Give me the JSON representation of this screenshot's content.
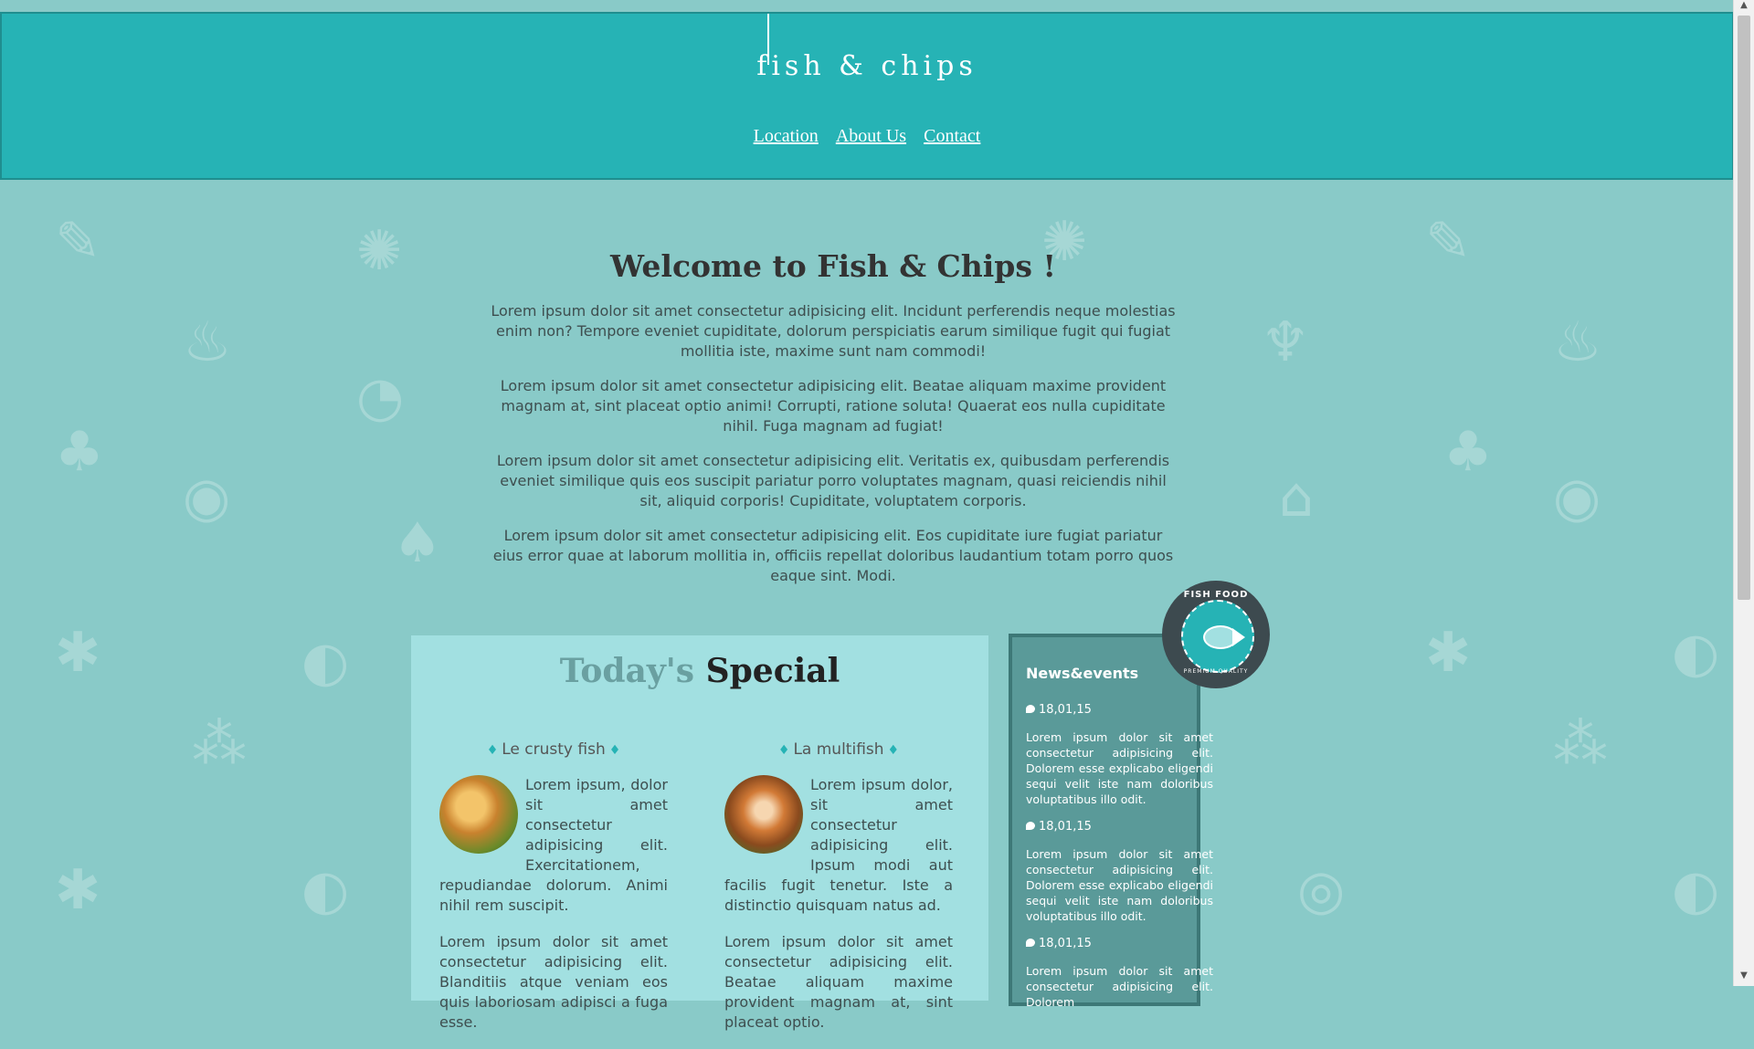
{
  "header": {
    "logo": "fish & chips",
    "nav": [
      {
        "label": "Location"
      },
      {
        "label": "About Us"
      },
      {
        "label": "Contact"
      }
    ]
  },
  "welcome": {
    "title": "Welcome to Fish & Chips !",
    "paragraphs": [
      "Lorem ipsum dolor sit amet consectetur adipisicing elit. Incidunt perferendis neque molestias enim non? Tempore eveniet cupiditate, dolorum perspiciatis earum similique fugit qui fugiat mollitia iste, maxime sunt nam commodi!",
      "Lorem ipsum dolor sit amet consectetur adipisicing elit. Beatae aliquam maxime provident magnam at, sint placeat optio animi! Corrupti, ratione soluta! Quaerat eos nulla cupiditate nihil. Fuga magnam ad fugiat!",
      "Lorem ipsum dolor sit amet consectetur adipisicing elit. Veritatis ex, quibusdam perferendis eveniet similique quis eos suscipit pariatur porro voluptates magnam, quasi reiciendis nihil sit, aliquid corporis! Cupiditate, voluptatem corporis.",
      "Lorem ipsum dolor sit amet consectetur adipisicing elit. Eos cupiditate iure fugiat pariatur eius error quae at laborum mollitia in, officiis repellat doloribus laudantium totam porro quos eaque sint. Modi."
    ]
  },
  "special": {
    "title_part1": "Today's",
    "title_part2": "Special",
    "dishes": [
      {
        "name": "Le crusty fish",
        "p1": "Lorem ipsum, dolor sit amet consectetur adipisicing elit. Exercitationem, repudiandae dolorum. Animi nihil rem suscipit.",
        "p2": "Lorem ipsum dolor sit amet consectetur adipisicing elit. Blanditiis atque veniam eos quis laboriosam adipisci a fuga esse."
      },
      {
        "name": "La multifish",
        "p1": "Lorem ipsum dolor, sit amet consectetur adipisicing elit. Ipsum modi aut facilis fugit tenetur. Iste a distinctio quisquam natus ad.",
        "p2": "Lorem ipsum dolor sit amet consectetur adipisicing elit. Beatae aliquam maxime provident magnam at, sint placeat optio."
      }
    ]
  },
  "news": {
    "title": "News&events",
    "items": [
      {
        "date": "18,01,15",
        "text": "Lorem ipsum dolor sit amet consectetur adipisicing elit. Dolorem esse explicabo eligendi sequi velit iste nam doloribus voluptatibus illo odit."
      },
      {
        "date": "18,01,15",
        "text": "Lorem ipsum dolor sit amet consectetur adipisicing elit. Dolorem esse explicabo eligendi sequi velit iste nam doloribus voluptatibus illo odit."
      },
      {
        "date": "18,01,15",
        "text": "Lorem ipsum dolor sit amet consectetur adipisicing elit. Dolorem"
      }
    ]
  },
  "badge": {
    "top_text": "FISH FOOD",
    "bottom_text": "PREMIUM QUALITY"
  },
  "colors": {
    "header_bg": "#26b3b5",
    "page_bg": "#89cac8",
    "special_bg": "#a2e0e1",
    "news_bg": "#5a9a99"
  }
}
